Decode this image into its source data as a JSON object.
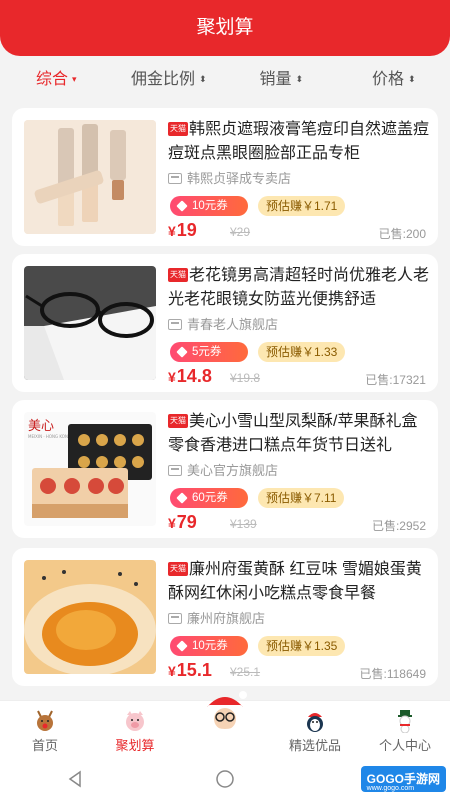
{
  "header": {
    "title": "聚划算"
  },
  "sort": [
    {
      "label": "综合",
      "arrow": "▾"
    },
    {
      "label": "佣金比例",
      "arrow": "⬍"
    },
    {
      "label": "销量",
      "arrow": "⬍"
    },
    {
      "label": "价格",
      "arrow": "⬍"
    }
  ],
  "tmall_tag": "天猫",
  "products": [
    {
      "title": "韩熙贞遮瑕液膏笔痘印自然遮盖痘痘斑点黑眼圈脸部正品专柜",
      "shop": "韩熙贞驿成专卖店",
      "coupon": "10元券",
      "earn": "预估赚￥1.71",
      "currency": "¥",
      "price": "19",
      "orig": "¥29",
      "sold": "已售:200"
    },
    {
      "title": "老花镜男高清超轻时尚优雅老人老光老花眼镜女防蓝光便携舒适",
      "shop": "青春老人旗舰店",
      "coupon": "5元券",
      "earn": "预估赚￥1.33",
      "currency": "¥",
      "price": "14.8",
      "orig": "¥19.8",
      "sold": "已售:17321"
    },
    {
      "title": "美心小雪山型凤梨酥/苹果酥礼盒零食香港进口糕点年货节日送礼",
      "shop": "美心官方旗舰店",
      "coupon": "60元券",
      "earn": "预估赚￥7.11",
      "currency": "¥",
      "price": "79",
      "orig": "¥139",
      "sold": "已售:2952"
    },
    {
      "title": "廉州府蛋黄酥 红豆味 雪媚娘蛋黄酥网红休闲小吃糕点零食早餐",
      "shop": "廉州府旗舰店",
      "coupon": "10元券",
      "earn": "预估赚￥1.35",
      "currency": "¥",
      "price": "15.1",
      "orig": "¥25.1",
      "sold": "已售:118649"
    }
  ],
  "thumb_text": {
    "brand": "美心",
    "brand_sub": "MEIXIN · HONG KONG"
  },
  "tabs": [
    {
      "label": "首页",
      "icon": "reindeer-icon"
    },
    {
      "label": "聚划算",
      "icon": "pig-icon"
    },
    {
      "label": "",
      "icon": "santa-icon"
    },
    {
      "label": "精选优品",
      "icon": "penguin-icon"
    },
    {
      "label": "个人中心",
      "icon": "snowman-icon"
    }
  ],
  "watermark": {
    "main": "GOGO手游网",
    "sub": "www.gogo.com"
  },
  "colors": {
    "primary": "#e8282b",
    "background": "#f3f3f3"
  }
}
